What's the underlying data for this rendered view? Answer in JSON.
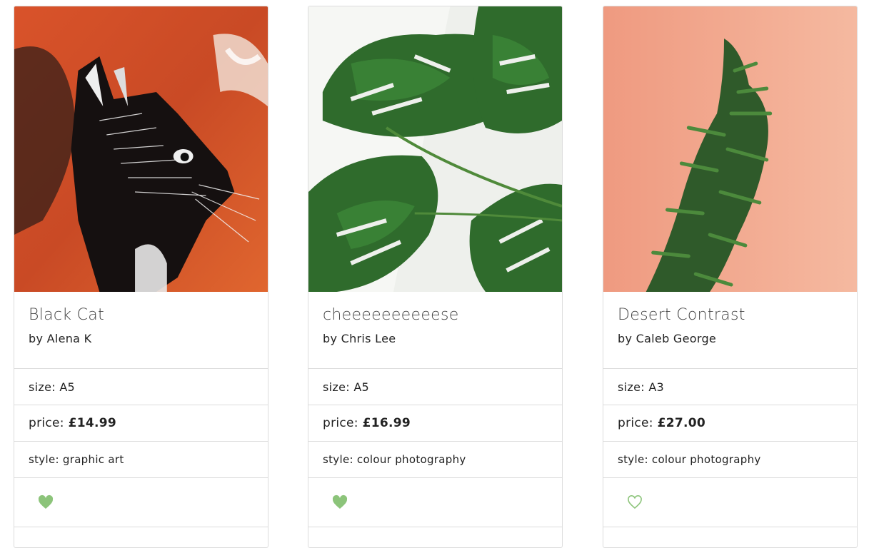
{
  "products": [
    {
      "title": "Black Cat",
      "artist": "by Alena K",
      "size_label": "size:",
      "size": "A5",
      "price_label": "price:",
      "price": "£14.99",
      "style_label": "style:",
      "style": "graphic art",
      "favourite": true
    },
    {
      "title": "cheeeeeeeeeese",
      "artist": "by Chris Lee",
      "size_label": "size:",
      "size": "A5",
      "price_label": "price:",
      "price": "£16.99",
      "style_label": "style:",
      "style": "colour photography",
      "favourite": true
    },
    {
      "title": "Desert Contrast",
      "artist": "by Caleb George",
      "size_label": "size:",
      "size": "A3",
      "price_label": "price:",
      "price": "£27.00",
      "style_label": "style:",
      "style": "colour photography",
      "favourite": false
    }
  ],
  "colors": {
    "heart": "#8cc47a",
    "border": "#dcdcdc"
  },
  "icons": {
    "favourite_filled": "heart-filled-icon",
    "favourite_outline": "heart-outline-icon"
  }
}
